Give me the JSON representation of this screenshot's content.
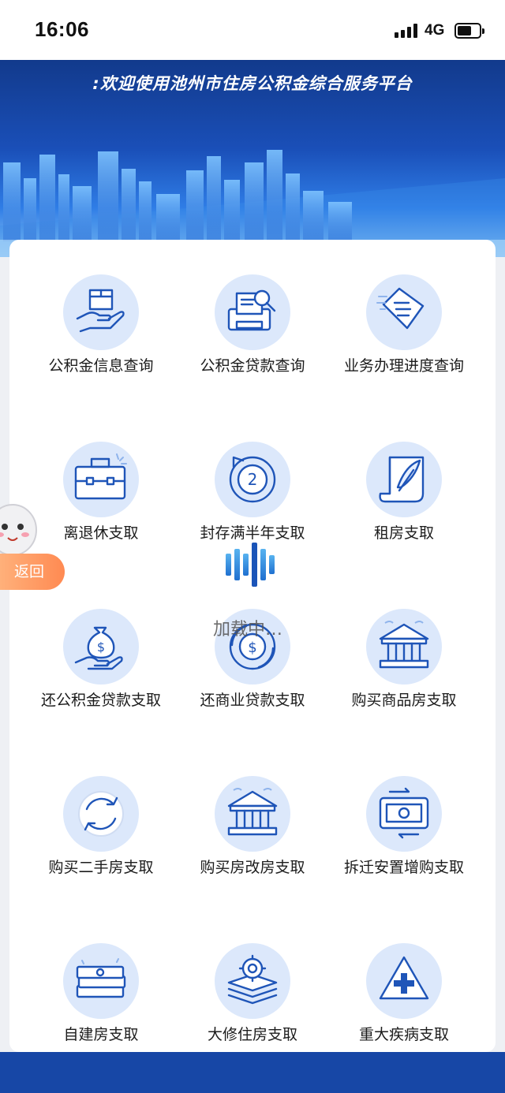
{
  "status_bar": {
    "time": "16:06",
    "network": "4G"
  },
  "banner": {
    "title": ":欢迎使用池州市住房公积金综合服务平台"
  },
  "grid": [
    {
      "label": "公积金信息查询",
      "icon": "box-hand-icon"
    },
    {
      "label": "公积金贷款查询",
      "icon": "printer-search-icon"
    },
    {
      "label": "业务办理进度查询",
      "icon": "document-progress-icon"
    },
    {
      "label": "离退休支取",
      "icon": "briefcase-icon"
    },
    {
      "label": "封存满半年支取",
      "icon": "circular-arrow-2-icon"
    },
    {
      "label": "租房支取",
      "icon": "scroll-feather-icon"
    },
    {
      "label": "还公积金贷款支取",
      "icon": "money-bag-hand-icon"
    },
    {
      "label": "还商业贷款支取",
      "icon": "coin-cycle-icon"
    },
    {
      "label": "购买商品房支取",
      "icon": "bank-building-icon"
    },
    {
      "label": "购买二手房支取",
      "icon": "refresh-cycle-icon"
    },
    {
      "label": "购买房改房支取",
      "icon": "bank-building-icon"
    },
    {
      "label": "拆迁安置增购支取",
      "icon": "money-exchange-icon"
    },
    {
      "label": "自建房支取",
      "icon": "cash-stack-icon"
    },
    {
      "label": "大修住房支取",
      "icon": "gear-stack-icon"
    },
    {
      "label": "重大疾病支取",
      "icon": "medical-cross-icon"
    }
  ],
  "back_button": {
    "label": "返回"
  },
  "loading": {
    "text": "加载中…"
  },
  "colors": {
    "accent": "#1a4fb8",
    "icon_bg": "#dce8fb",
    "icon_stroke": "#1f55b8",
    "back_button": "#ff8a52"
  }
}
